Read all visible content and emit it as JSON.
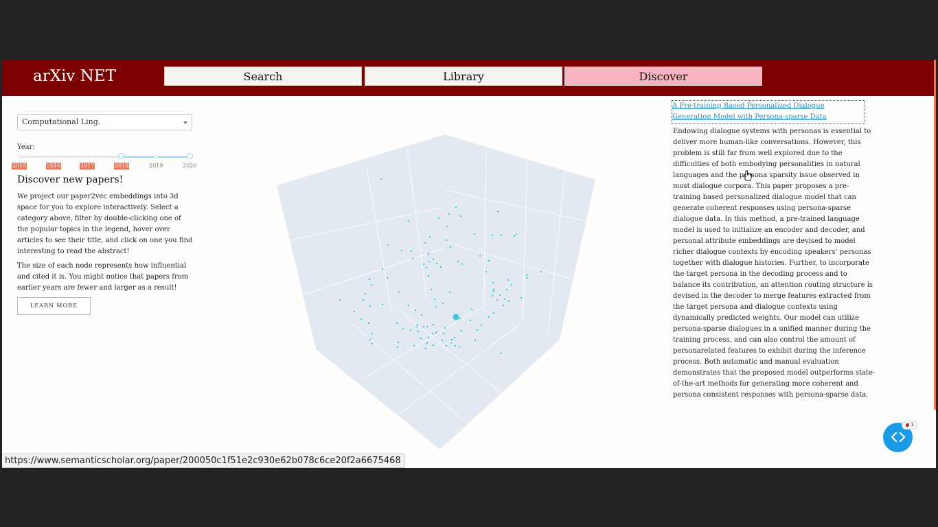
{
  "header": {
    "logo": "arXiv NET",
    "nav": [
      {
        "label": "Search"
      },
      {
        "label": "Library"
      },
      {
        "label": "Discover"
      }
    ]
  },
  "filters": {
    "category": "Computational Ling.",
    "year_label": "Year:",
    "years": [
      "2015",
      "2016",
      "2017",
      "2018",
      "2019",
      "2020"
    ],
    "selected_range": [
      "2018",
      "2020"
    ]
  },
  "intro": {
    "title": "Discover new papers!",
    "paragraph1": "We project our paper2vec embeddings into 3d space for you to explore interactively. Select a category above, filter by double-clicking one of the popular topics in the legend, hover over articles to see their title, and click on one you find interesting to read the abstract!",
    "paragraph2": "The size of each node represents how influential and cited it is. You might notice that papers from earlier years are fewer and larger as a result!",
    "learn_more": "LEARN MORE"
  },
  "paper": {
    "title": "A Pre-training Based Personalized Dialogue Generation Model with Persona-sparse Data",
    "abstract": "Endowing dialogue systems with personas is essential to deliver more human-like conversations. However, this problem is still far from well explored due to the difficulties of both embodying personalities in natural languages and the persona sparsity issue observed in most dialogue corpora. This paper proposes a pre-training based personalized dialogue model that can generate coherent responses using persona-sparse dialogue data. In this method, a pre-trained language model is used to initialize an encoder and decoder, and personal attribute embeddings are devised to model richer dialogue contexts by encoding speakers' personas together with dialogue histories. Further, to incorporate the target persona in the decoding process and to balance its contribution, an attention routing structure is devised in the decoder to merge features extracted from the target persona and dialogue contexts using dynamically predicted weights. Our model can utilize persona-sparse dialogues in a unified manner during the training process, and can also control the amount of personarelated features to exhibit during the inference process. Both automatic and manual evaluation demonstrates that the proposed model outperforms state-of-the-art methods for generating more coherent and persona consistent responses with persona-sparse data."
  },
  "code_widget": {
    "badge_count": "1",
    "icon": "code-brackets-icon"
  },
  "status_bar": {
    "url": "https://www.semanticscholar.org/paper/200050c1f51e2c930e62b078c6ce20f2a6675468"
  },
  "colors": {
    "header": "#7d0000",
    "discover_active": "#f8b4c2",
    "node": "#3cc8dc",
    "year_active": "#e8765a",
    "link": "#1f8fbf"
  }
}
